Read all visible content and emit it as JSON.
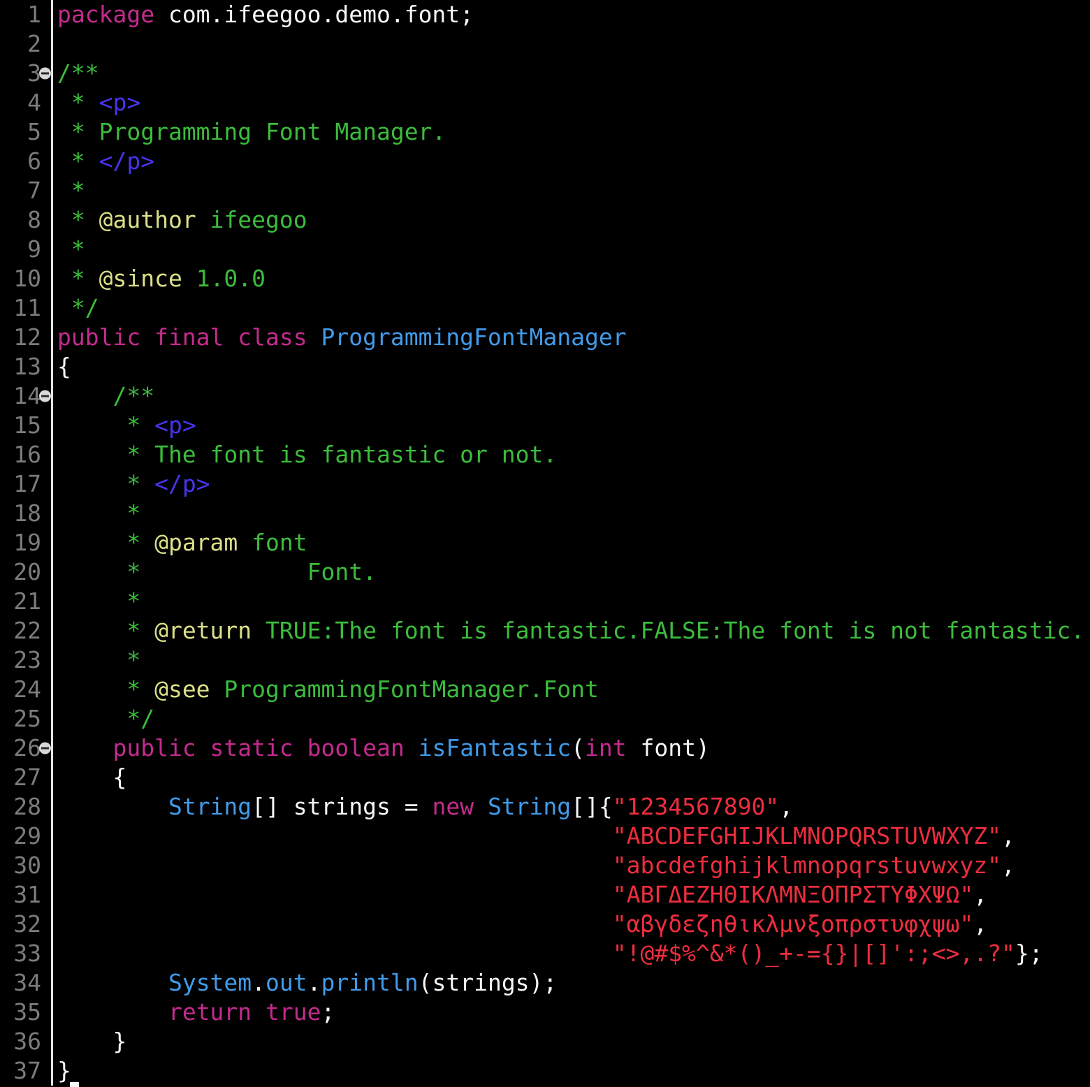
{
  "colors": {
    "background": "#000000",
    "plain": "#f7f7f7",
    "keyword": "#c42b8e",
    "comment": "#3cbc3c",
    "doctag": "#d9e087",
    "htmltag": "#4634ec",
    "type": "#419be9",
    "string": "#ee2d3e",
    "line_number": "#7c7c7c",
    "gutter_separator": "#e3e3e3",
    "fold_bg": "#d9d9d9",
    "fold_glyph": "#2b2b2b"
  },
  "editor": {
    "language": "java",
    "caret_visible": true,
    "lines": [
      {
        "n": "1",
        "fold": false,
        "tokens": [
          {
            "c": "keyword",
            "t": "package"
          },
          {
            "c": "plain",
            "t": " com.ifeegoo.demo.font;"
          }
        ]
      },
      {
        "n": "2",
        "fold": false,
        "tokens": []
      },
      {
        "n": "3",
        "fold": true,
        "tokens": [
          {
            "c": "comment",
            "t": "/**"
          }
        ]
      },
      {
        "n": "4",
        "fold": false,
        "tokens": [
          {
            "c": "comment",
            "t": " * "
          },
          {
            "c": "htmltag",
            "t": "<p>"
          }
        ]
      },
      {
        "n": "5",
        "fold": false,
        "tokens": [
          {
            "c": "comment",
            "t": " * Programming Font Manager."
          }
        ]
      },
      {
        "n": "6",
        "fold": false,
        "tokens": [
          {
            "c": "comment",
            "t": " * "
          },
          {
            "c": "htmltag",
            "t": "</p>"
          }
        ]
      },
      {
        "n": "7",
        "fold": false,
        "tokens": [
          {
            "c": "comment",
            "t": " *"
          }
        ]
      },
      {
        "n": "8",
        "fold": false,
        "tokens": [
          {
            "c": "comment",
            "t": " * "
          },
          {
            "c": "doctag",
            "t": "@author"
          },
          {
            "c": "comment",
            "t": " ifeegoo"
          }
        ]
      },
      {
        "n": "9",
        "fold": false,
        "tokens": [
          {
            "c": "comment",
            "t": " *"
          }
        ]
      },
      {
        "n": "10",
        "fold": false,
        "tokens": [
          {
            "c": "comment",
            "t": " * "
          },
          {
            "c": "doctag",
            "t": "@since"
          },
          {
            "c": "comment",
            "t": " 1.0.0"
          }
        ]
      },
      {
        "n": "11",
        "fold": false,
        "tokens": [
          {
            "c": "comment",
            "t": " */"
          }
        ]
      },
      {
        "n": "12",
        "fold": false,
        "tokens": [
          {
            "c": "keyword",
            "t": "public final class"
          },
          {
            "c": "plain",
            "t": " "
          },
          {
            "c": "type",
            "t": "ProgrammingFontManager"
          }
        ]
      },
      {
        "n": "13",
        "fold": false,
        "tokens": [
          {
            "c": "plain",
            "t": "{"
          }
        ]
      },
      {
        "n": "14",
        "fold": true,
        "tokens": [
          {
            "c": "comment",
            "t": "    /**"
          }
        ]
      },
      {
        "n": "15",
        "fold": false,
        "tokens": [
          {
            "c": "comment",
            "t": "     * "
          },
          {
            "c": "htmltag",
            "t": "<p>"
          }
        ]
      },
      {
        "n": "16",
        "fold": false,
        "tokens": [
          {
            "c": "comment",
            "t": "     * The font is fantastic or not."
          }
        ]
      },
      {
        "n": "17",
        "fold": false,
        "tokens": [
          {
            "c": "comment",
            "t": "     * "
          },
          {
            "c": "htmltag",
            "t": "</p>"
          }
        ]
      },
      {
        "n": "18",
        "fold": false,
        "tokens": [
          {
            "c": "comment",
            "t": "     *"
          }
        ]
      },
      {
        "n": "19",
        "fold": false,
        "tokens": [
          {
            "c": "comment",
            "t": "     * "
          },
          {
            "c": "doctag",
            "t": "@param"
          },
          {
            "c": "comment",
            "t": " font"
          }
        ]
      },
      {
        "n": "20",
        "fold": false,
        "tokens": [
          {
            "c": "comment",
            "t": "     *            Font."
          }
        ]
      },
      {
        "n": "21",
        "fold": false,
        "tokens": [
          {
            "c": "comment",
            "t": "     *"
          }
        ]
      },
      {
        "n": "22",
        "fold": false,
        "tokens": [
          {
            "c": "comment",
            "t": "     * "
          },
          {
            "c": "doctag",
            "t": "@return"
          },
          {
            "c": "comment",
            "t": " TRUE:The font is fantastic.FALSE:The font is not fantastic."
          }
        ]
      },
      {
        "n": "23",
        "fold": false,
        "tokens": [
          {
            "c": "comment",
            "t": "     *"
          }
        ]
      },
      {
        "n": "24",
        "fold": false,
        "tokens": [
          {
            "c": "comment",
            "t": "     * "
          },
          {
            "c": "doctag",
            "t": "@see"
          },
          {
            "c": "comment",
            "t": " ProgrammingFontManager.Font"
          }
        ]
      },
      {
        "n": "25",
        "fold": false,
        "tokens": [
          {
            "c": "comment",
            "t": "     */"
          }
        ]
      },
      {
        "n": "26",
        "fold": true,
        "tokens": [
          {
            "c": "plain",
            "t": "    "
          },
          {
            "c": "keyword",
            "t": "public static boolean"
          },
          {
            "c": "plain",
            "t": " "
          },
          {
            "c": "type",
            "t": "isFantastic"
          },
          {
            "c": "plain",
            "t": "("
          },
          {
            "c": "keyword",
            "t": "int"
          },
          {
            "c": "plain",
            "t": " font)"
          }
        ]
      },
      {
        "n": "27",
        "fold": false,
        "tokens": [
          {
            "c": "plain",
            "t": "    {"
          }
        ]
      },
      {
        "n": "28",
        "fold": false,
        "tokens": [
          {
            "c": "plain",
            "t": "        "
          },
          {
            "c": "type",
            "t": "String"
          },
          {
            "c": "plain",
            "t": "[] strings = "
          },
          {
            "c": "keyword",
            "t": "new"
          },
          {
            "c": "plain",
            "t": " "
          },
          {
            "c": "type",
            "t": "String"
          },
          {
            "c": "plain",
            "t": "[]{"
          },
          {
            "c": "str",
            "t": "\"1234567890\""
          },
          {
            "c": "plain",
            "t": ","
          }
        ]
      },
      {
        "n": "29",
        "fold": false,
        "tokens": [
          {
            "c": "plain",
            "t": "                                        "
          },
          {
            "c": "str",
            "t": "\"ABCDEFGHIJKLMNOPQRSTUVWXYZ\""
          },
          {
            "c": "plain",
            "t": ","
          }
        ]
      },
      {
        "n": "30",
        "fold": false,
        "tokens": [
          {
            "c": "plain",
            "t": "                                        "
          },
          {
            "c": "str",
            "t": "\"abcdefghijklmnopqrstuvwxyz\""
          },
          {
            "c": "plain",
            "t": ","
          }
        ]
      },
      {
        "n": "31",
        "fold": false,
        "tokens": [
          {
            "c": "plain",
            "t": "                                        "
          },
          {
            "c": "str",
            "t": "\"ΑΒΓΔΕΖΗΘΙΚΛΜΝΞΟΠΡΣΤΥΦΧΨΩ\""
          },
          {
            "c": "plain",
            "t": ","
          }
        ]
      },
      {
        "n": "32",
        "fold": false,
        "tokens": [
          {
            "c": "plain",
            "t": "                                        "
          },
          {
            "c": "str",
            "t": "\"αβγδεζηθικλμνξοπρστυφχψω\""
          },
          {
            "c": "plain",
            "t": ","
          }
        ]
      },
      {
        "n": "33",
        "fold": false,
        "tokens": [
          {
            "c": "plain",
            "t": "                                        "
          },
          {
            "c": "str",
            "t": "\"!@#$%^&*()_+-={}|[]':;<>,.?\""
          },
          {
            "c": "plain",
            "t": "};"
          }
        ]
      },
      {
        "n": "34",
        "fold": false,
        "tokens": [
          {
            "c": "plain",
            "t": "        "
          },
          {
            "c": "type",
            "t": "System"
          },
          {
            "c": "plain",
            "t": "."
          },
          {
            "c": "type",
            "t": "out"
          },
          {
            "c": "plain",
            "t": "."
          },
          {
            "c": "type",
            "t": "println"
          },
          {
            "c": "plain",
            "t": "(strings);"
          }
        ]
      },
      {
        "n": "35",
        "fold": false,
        "tokens": [
          {
            "c": "plain",
            "t": "        "
          },
          {
            "c": "keyword",
            "t": "return true"
          },
          {
            "c": "plain",
            "t": ";"
          }
        ]
      },
      {
        "n": "36",
        "fold": false,
        "tokens": [
          {
            "c": "plain",
            "t": "    }"
          }
        ]
      },
      {
        "n": "37",
        "fold": false,
        "tokens": [
          {
            "c": "plain",
            "t": "}"
          }
        ]
      }
    ]
  }
}
